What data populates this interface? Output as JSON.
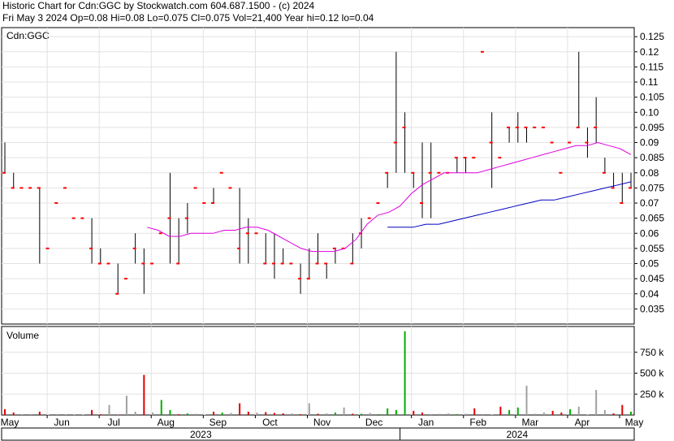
{
  "header": {
    "title_line": "Historic Chart for Cdn:GGC by Stockwatch.com 604.687.1500 - (c) 2024",
    "quote_line": "Fri May  3 2024   Op=0.08  Hi=0.08  Lo=0.075  Cl=0.075  Vol=21,400  Year hi=0.12  lo=0.04"
  },
  "chart_data": [
    {
      "type": "ohlc",
      "title": "Cdn:GGC",
      "price_axis": {
        "ticks": [
          "0.125",
          "0.12",
          "0.115",
          "0.11",
          "0.105",
          "0.10",
          "0.095",
          "0.09",
          "0.085",
          "0.08",
          "0.075",
          "0.07",
          "0.065",
          "0.06",
          "0.055",
          "0.05",
          "0.045",
          "0.04",
          "0.035"
        ],
        "ylim": [
          0.03,
          0.128
        ]
      },
      "x_axis": {
        "months": [
          "May",
          "Jun",
          "Jul",
          "Aug",
          "Sep",
          "Oct",
          "Nov",
          "Dec",
          "Jan",
          "Feb",
          "Mar",
          "Apr",
          "May"
        ],
        "years": [
          "2023",
          "2024"
        ]
      },
      "colors": {
        "up_close": "#ff0000",
        "bar": "#000000",
        "ma_short": "#e000e0",
        "ma_long": "#0000c0",
        "vol_up": "#00b000",
        "vol_down": "#e00000",
        "vol_flat": "#a0a0a0"
      },
      "bars": [
        [
          0.09,
          0.09,
          0.08,
          0.08
        ],
        [
          0.08,
          0.08,
          0.075,
          0.075
        ],
        [
          0.075,
          0.075,
          0.075,
          0.075
        ],
        [
          0.075,
          0.075,
          0.075,
          0.075
        ],
        [
          0.075,
          0.075,
          0.05,
          0.075
        ],
        [
          0.055,
          0.055,
          0.055,
          0.055
        ],
        [
          0.07,
          0.07,
          0.07,
          0.07
        ],
        [
          0.075,
          0.075,
          0.075,
          0.075
        ],
        [
          0.065,
          0.065,
          0.065,
          0.065
        ],
        [
          0.065,
          0.065,
          0.065,
          0.065
        ],
        [
          0.065,
          0.065,
          0.05,
          0.055
        ],
        [
          0.055,
          0.055,
          0.05,
          0.05
        ],
        [
          0.05,
          0.05,
          0.05,
          0.05
        ],
        [
          0.05,
          0.05,
          0.04,
          0.04
        ],
        [
          0.045,
          0.045,
          0.045,
          0.045
        ],
        [
          0.06,
          0.06,
          0.05,
          0.055
        ],
        [
          0.055,
          0.055,
          0.04,
          0.05
        ],
        [
          0.05,
          0.05,
          0.05,
          0.05
        ],
        [
          0.06,
          0.06,
          0.06,
          0.06
        ],
        [
          0.08,
          0.08,
          0.05,
          0.065
        ],
        [
          0.065,
          0.065,
          0.05,
          0.05
        ],
        [
          0.07,
          0.07,
          0.06,
          0.065
        ],
        [
          0.075,
          0.075,
          0.075,
          0.075
        ],
        [
          0.07,
          0.07,
          0.07,
          0.07
        ],
        [
          0.075,
          0.075,
          0.07,
          0.07
        ],
        [
          0.08,
          0.08,
          0.08,
          0.08
        ],
        [
          0.075,
          0.075,
          0.075,
          0.075
        ],
        [
          0.075,
          0.075,
          0.05,
          0.055
        ],
        [
          0.065,
          0.065,
          0.05,
          0.06
        ],
        [
          0.06,
          0.06,
          0.06,
          0.06
        ],
        [
          0.06,
          0.06,
          0.05,
          0.05
        ],
        [
          0.06,
          0.06,
          0.045,
          0.05
        ],
        [
          0.055,
          0.055,
          0.05,
          0.05
        ],
        [
          0.05,
          0.05,
          0.05,
          0.05
        ],
        [
          0.05,
          0.05,
          0.04,
          0.045
        ],
        [
          0.055,
          0.055,
          0.045,
          0.045
        ],
        [
          0.06,
          0.06,
          0.05,
          0.05
        ],
        [
          0.05,
          0.05,
          0.045,
          0.05
        ],
        [
          0.055,
          0.055,
          0.05,
          0.055
        ],
        [
          0.055,
          0.055,
          0.055,
          0.055
        ],
        [
          0.06,
          0.06,
          0.05,
          0.05
        ],
        [
          0.065,
          0.065,
          0.055,
          0.06
        ],
        [
          0.065,
          0.065,
          0.065,
          0.065
        ],
        [
          0.07,
          0.07,
          0.07,
          0.07
        ],
        [
          0.08,
          0.08,
          0.075,
          0.08
        ],
        [
          0.12,
          0.12,
          0.08,
          0.09
        ],
        [
          0.1,
          0.1,
          0.08,
          0.095
        ],
        [
          0.08,
          0.08,
          0.075,
          0.08
        ],
        [
          0.09,
          0.09,
          0.065,
          0.07
        ],
        [
          0.09,
          0.09,
          0.065,
          0.08
        ],
        [
          0.08,
          0.08,
          0.08,
          0.08
        ],
        [
          0.08,
          0.08,
          0.08,
          0.08
        ],
        [
          0.085,
          0.085,
          0.08,
          0.085
        ],
        [
          0.085,
          0.085,
          0.08,
          0.085
        ],
        [
          0.085,
          0.085,
          0.085,
          0.085
        ],
        [
          0.12,
          0.12,
          0.12,
          0.12
        ],
        [
          0.1,
          0.1,
          0.075,
          0.09
        ],
        [
          0.085,
          0.085,
          0.085,
          0.085
        ],
        [
          0.095,
          0.095,
          0.09,
          0.095
        ],
        [
          0.1,
          0.1,
          0.09,
          0.095
        ],
        [
          0.095,
          0.095,
          0.09,
          0.095
        ],
        [
          0.095,
          0.095,
          0.095,
          0.095
        ],
        [
          0.095,
          0.095,
          0.095,
          0.095
        ],
        [
          0.09,
          0.09,
          0.09,
          0.09
        ],
        [
          0.08,
          0.08,
          0.08,
          0.08
        ],
        [
          0.09,
          0.09,
          0.09,
          0.09
        ],
        [
          0.12,
          0.12,
          0.095,
          0.095
        ],
        [
          0.095,
          0.095,
          0.085,
          0.09
        ],
        [
          0.105,
          0.105,
          0.09,
          0.095
        ],
        [
          0.085,
          0.085,
          0.08,
          0.08
        ],
        [
          0.08,
          0.08,
          0.075,
          0.075
        ],
        [
          0.08,
          0.08,
          0.07,
          0.07
        ],
        [
          0.08,
          0.08,
          0.075,
          0.075
        ]
      ],
      "ma_short": [
        0.062,
        0.061,
        0.059,
        0.059,
        0.06,
        0.06,
        0.06,
        0.061,
        0.061,
        0.062,
        0.062,
        0.061,
        0.059,
        0.057,
        0.055,
        0.054,
        0.054,
        0.054,
        0.055,
        0.058,
        0.063,
        0.066,
        0.067,
        0.069,
        0.073,
        0.076,
        0.078,
        0.08,
        0.08,
        0.08,
        0.08,
        0.081,
        0.082,
        0.083,
        0.084,
        0.085,
        0.086,
        0.087,
        0.088,
        0.089,
        0.089,
        0.09,
        0.089,
        0.088,
        0.086
      ],
      "ma_long": [
        0.062,
        0.062,
        0.062,
        0.063,
        0.063,
        0.064,
        0.065,
        0.066,
        0.067,
        0.068,
        0.069,
        0.07,
        0.071,
        0.071,
        0.072,
        0.073,
        0.074,
        0.075,
        0.076,
        0.077
      ],
      "volume_panel": {
        "label": "Volume",
        "ticks": [
          "750 k",
          "500 k",
          "250 k"
        ],
        "ylim": [
          0,
          1000000
        ],
        "values": [
          70000,
          30000,
          8000,
          10000,
          40000,
          5000,
          10000,
          8000,
          6000,
          5000,
          60000,
          10000,
          120000,
          5000,
          230000,
          40000,
          480000,
          30000,
          180000,
          60000,
          10000,
          20000,
          15000,
          5000,
          40000,
          30000,
          25000,
          140000,
          40000,
          30000,
          35000,
          25000,
          20000,
          20000,
          10000,
          140000,
          15000,
          20000,
          30000,
          90000,
          15000,
          15000,
          25000,
          10000,
          80000,
          60000,
          1000000,
          50000,
          30000,
          10000,
          15000,
          20000,
          10000,
          15000,
          80000,
          10000,
          5000,
          100000,
          60000,
          90000,
          350000,
          15000,
          30000,
          50000,
          30000,
          70000,
          100000,
          5000,
          300000,
          60000,
          20000,
          120000,
          40000
        ],
        "kinds": [
          "d",
          "d",
          "f",
          "f",
          "d",
          "f",
          "f",
          "f",
          "f",
          "f",
          "d",
          "d",
          "f",
          "d",
          "f",
          "f",
          "d",
          "f",
          "u",
          "u",
          "d",
          "u",
          "f",
          "f",
          "d",
          "u",
          "f",
          "d",
          "d",
          "f",
          "d",
          "d",
          "d",
          "f",
          "d",
          "f",
          "d",
          "f",
          "u",
          "f",
          "d",
          "u",
          "f",
          "u",
          "u",
          "u",
          "u",
          "d",
          "d",
          "f",
          "f",
          "f",
          "u",
          "f",
          "d",
          "f",
          "f",
          "d",
          "u",
          "u",
          "f",
          "f",
          "f",
          "d",
          "d",
          "u",
          "f",
          "f",
          "f",
          "f",
          "d",
          "d",
          "u"
        ]
      }
    }
  ]
}
